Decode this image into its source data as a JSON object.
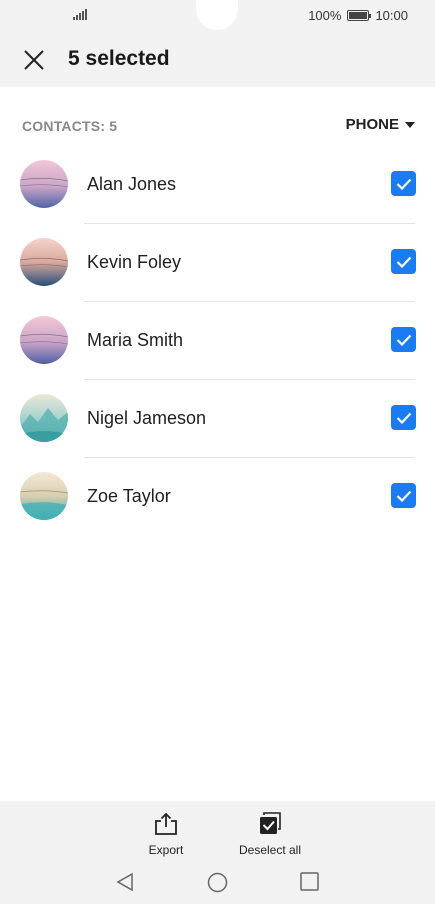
{
  "status_bar": {
    "battery_percent": "100%",
    "time": "10:00",
    "signal_icon": "signal-icon",
    "battery_icon": "battery-icon"
  },
  "header": {
    "title": "5 selected",
    "close_icon": "close-icon"
  },
  "list_header": {
    "count_label": "CONTACTS: 5",
    "filter_label": "PHONE"
  },
  "contacts": [
    {
      "name": "Alan Jones",
      "checked": true,
      "avatar_theme": "pink-blue"
    },
    {
      "name": "Kevin Foley",
      "checked": true,
      "avatar_theme": "peach-navy"
    },
    {
      "name": "Maria Smith",
      "checked": true,
      "avatar_theme": "pink-blue"
    },
    {
      "name": "Nigel Jameson",
      "checked": true,
      "avatar_theme": "teal-mountain"
    },
    {
      "name": "Zoe Taylor",
      "checked": true,
      "avatar_theme": "sand-teal"
    }
  ],
  "bottom_actions": {
    "export_label": "Export",
    "deselect_label": "Deselect all"
  },
  "colors": {
    "accent": "#1a7bf2",
    "bar_background": "#f2f2f2"
  }
}
